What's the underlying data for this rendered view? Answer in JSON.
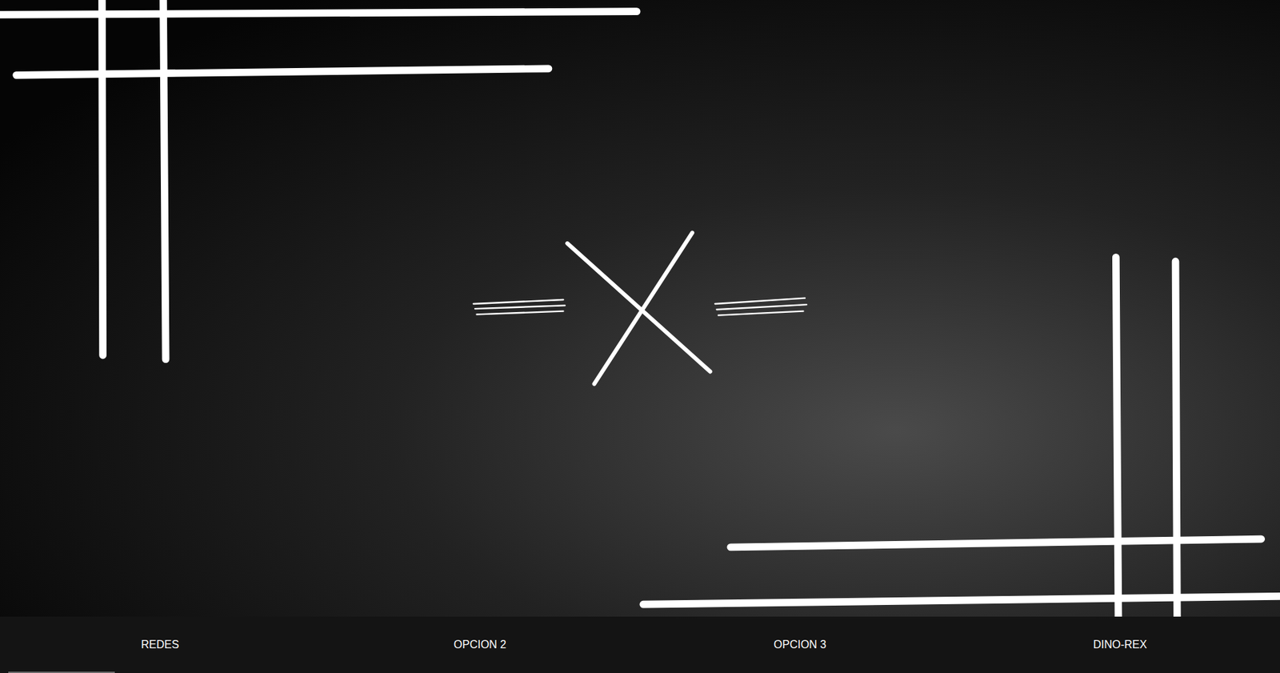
{
  "hero": {
    "kind": "photo"
  },
  "nav": {
    "items": [
      {
        "label": "REDES",
        "selected": true
      },
      {
        "label": "OPCION 2",
        "selected": false
      },
      {
        "label": "OPCION 3",
        "selected": false
      },
      {
        "label": "DINO-REX",
        "selected": false
      }
    ]
  }
}
